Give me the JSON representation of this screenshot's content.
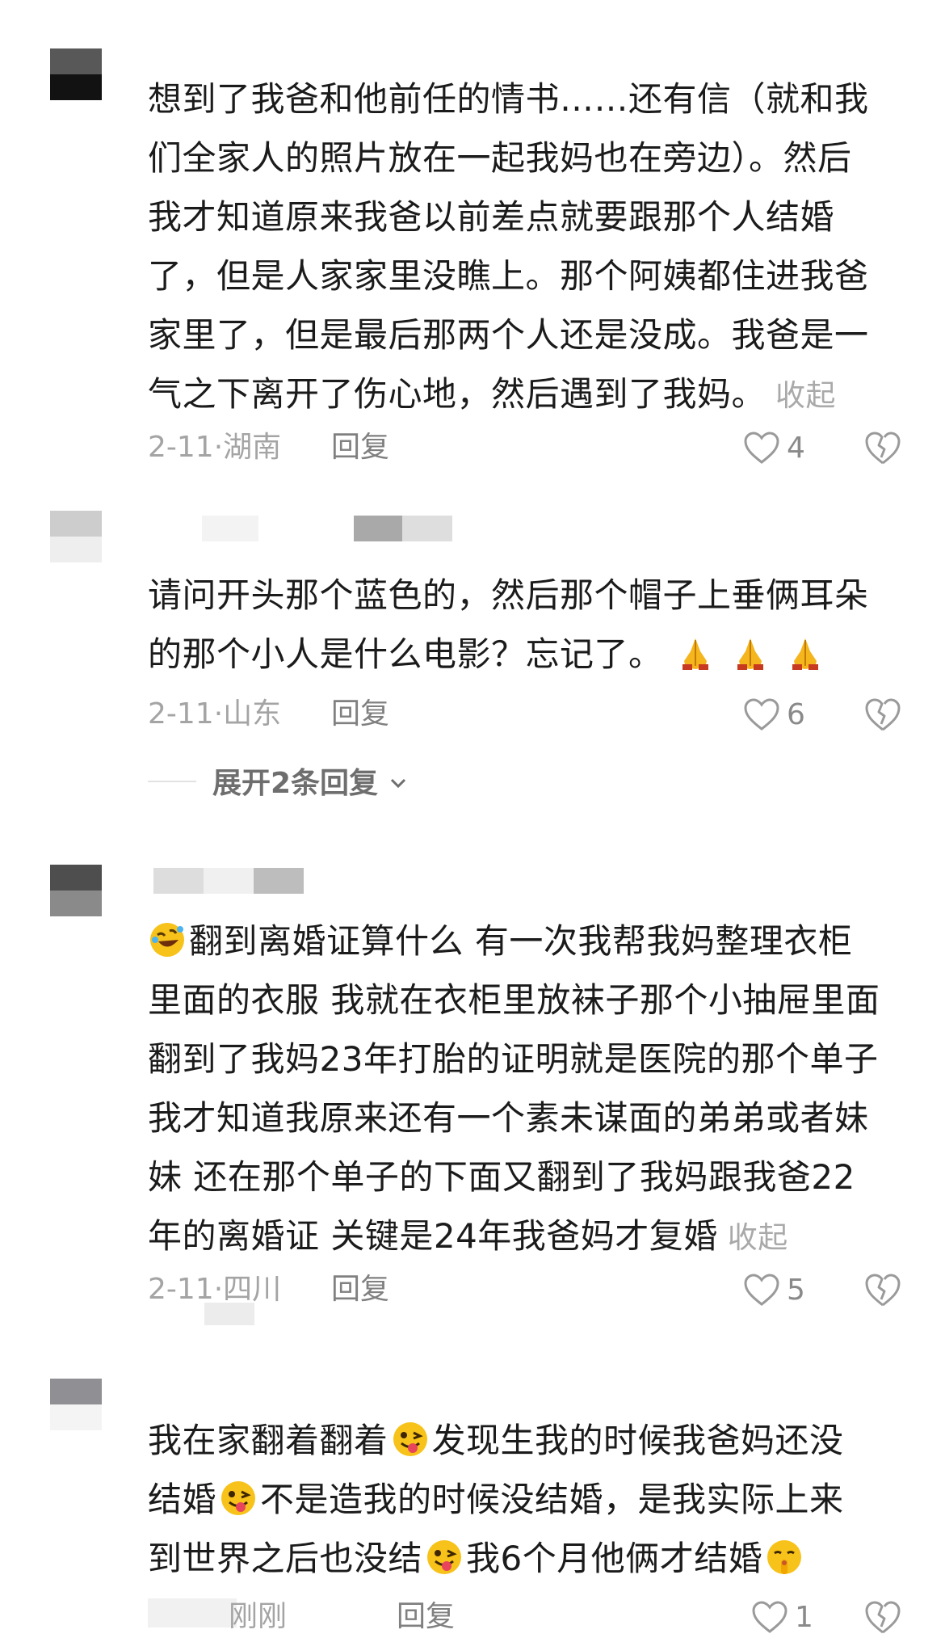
{
  "comments": [
    {
      "lines": [
        "想到了我爸和他前任的情书……还有信（就和我",
        "们全家人的照片放在一起我妈也在旁边）。然后",
        "我才知道原来我爸以前差点就要跟那个人结婚",
        "了，但是人家家里没瞧上。那个阿姨都住进我爸",
        "家里了，但是最后那两个人还是没成。我爸是一",
        "气之下离开了伤心地，然后遇到了我妈。"
      ],
      "collapse": "收起",
      "date": "2-11",
      "location": "湖南",
      "reply": "回复",
      "likes": "4"
    },
    {
      "lines": [
        "请问开头那个蓝色的，然后那个帽子上垂俩耳朵",
        "的那个小人是什么电影？忘记了。"
      ],
      "emoji_after": [
        "folded-hands-emoji",
        "folded-hands-emoji",
        "folded-hands-emoji"
      ],
      "date": "2-11",
      "location": "山东",
      "reply": "回复",
      "likes": "6",
      "expand": "展开2条回复"
    },
    {
      "lines": [
        "翻到离婚证算什么 有一次我帮我妈整理衣柜",
        "里面的衣服 我就在衣柜里放袜子那个小抽屉里面",
        "翻到了我妈23年打胎的证明就是医院的那个单子",
        "我才知道我原来还有一个素未谋面的弟弟或者妹",
        "妹 还在那个单子的下面又翻到了我妈跟我爸22",
        "年的离婚证 关键是24年我爸妈才复婚"
      ],
      "emoji_before": "rofl-emoji",
      "collapse": "收起",
      "date": "2-11",
      "location": "四川",
      "reply": "回复",
      "likes": "5"
    },
    {
      "segments": [
        [
          "我在家翻着翻着",
          "发现生我的时候我爸妈还没"
        ],
        [
          "结婚",
          "不是造我的时候没结婚，是我实际上来"
        ],
        [
          "到世界之后也没结",
          "我6个月他俩才结婚"
        ]
      ],
      "date_location": "刚刚",
      "reply": "回复",
      "likes": "1"
    }
  ],
  "colors": {
    "text": "#1b1b1b",
    "meta": "#a4a4a4",
    "icon": "#9a9a9a"
  },
  "icons": [
    "heart-outline-icon",
    "broken-heart-icon",
    "chevron-down-icon"
  ]
}
